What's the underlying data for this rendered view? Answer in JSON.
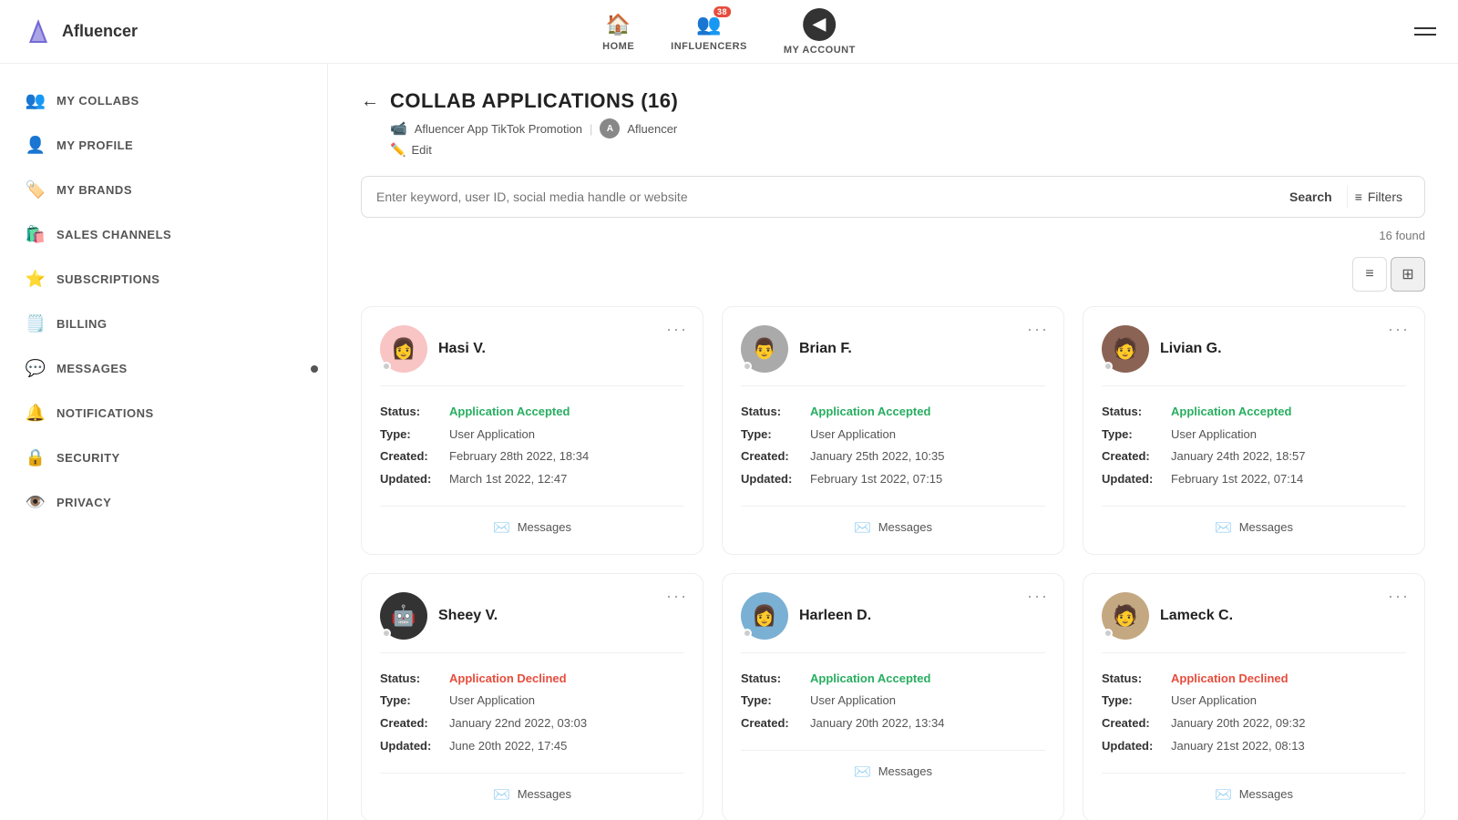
{
  "logo": {
    "text": "Afluencer"
  },
  "topnav": {
    "home_label": "HOME",
    "influencers_label": "INFLUENCERS",
    "my_account_label": "MY ACCOUNT",
    "badge_count": "38"
  },
  "sidebar": {
    "items": [
      {
        "id": "my-collabs",
        "label": "MY COLLABS",
        "icon": "👥"
      },
      {
        "id": "my-profile",
        "label": "MY PROFILE",
        "icon": "👤"
      },
      {
        "id": "my-brands",
        "label": "MY BRANDS",
        "icon": "🏷️"
      },
      {
        "id": "sales-channels",
        "label": "SALES CHANNELS",
        "icon": "🛍️"
      },
      {
        "id": "subscriptions",
        "label": "SUBSCRIPTIONS",
        "icon": "⭐"
      },
      {
        "id": "billing",
        "label": "BILLING",
        "icon": "🗒️"
      },
      {
        "id": "messages",
        "label": "MESSAGES",
        "icon": "💬"
      },
      {
        "id": "notifications",
        "label": "NOTIFICATIONS",
        "icon": "🔔"
      },
      {
        "id": "security",
        "label": "SECURITY",
        "icon": "🔒"
      },
      {
        "id": "privacy",
        "label": "PRIVACY",
        "icon": "👁️"
      }
    ]
  },
  "page": {
    "title": "COLLAB APPLICATIONS (16)",
    "collab_name": "Afluencer App TikTok Promotion",
    "brand_name": "Afluencer",
    "edit_label": "Edit",
    "back_label": "←"
  },
  "search": {
    "placeholder": "Enter keyword, user ID, social media handle or website",
    "button_label": "Search",
    "filter_label": "Filters",
    "results": "16 found"
  },
  "view_toggle": {
    "list_icon": "≡",
    "grid_icon": "⊞"
  },
  "cards": [
    {
      "name": "Hasi V.",
      "avatar_color": "av-pink",
      "avatar_emoji": "👩",
      "status": "Application Accepted",
      "status_type": "accepted",
      "type": "User Application",
      "created": "February 28th 2022, 18:34",
      "updated": "March 1st 2022, 12:47",
      "messages_label": "Messages"
    },
    {
      "name": "Brian F.",
      "avatar_color": "av-gray",
      "avatar_emoji": "👨",
      "status": "Application Accepted",
      "status_type": "accepted",
      "type": "User Application",
      "created": "January 25th 2022, 10:35",
      "updated": "February 1st 2022, 07:15",
      "messages_label": "Messages"
    },
    {
      "name": "Livian G.",
      "avatar_color": "av-brown",
      "avatar_emoji": "🧑",
      "status": "Application Accepted",
      "status_type": "accepted",
      "type": "User Application",
      "created": "January 24th 2022, 18:57",
      "updated": "February 1st 2022, 07:14",
      "messages_label": "Messages"
    },
    {
      "name": "Sheey V.",
      "avatar_color": "av-dark",
      "avatar_emoji": "🤖",
      "status": "Application Declined",
      "status_type": "declined",
      "type": "User Application",
      "created": "January 22nd 2022, 03:03",
      "updated": "June 20th 2022, 17:45",
      "messages_label": "Messages"
    },
    {
      "name": "Harleen D.",
      "avatar_color": "av-blue",
      "avatar_emoji": "👩",
      "status": "Application Accepted",
      "status_type": "accepted",
      "type": "User Application",
      "created": "January 20th 2022, 13:34",
      "updated": "",
      "messages_label": "Messages"
    },
    {
      "name": "Lameck C.",
      "avatar_color": "av-tan",
      "avatar_emoji": "🧑",
      "status": "Application Declined",
      "status_type": "declined",
      "type": "User Application",
      "created": "January 20th 2022, 09:32",
      "updated": "January 21st 2022, 08:13",
      "messages_label": "Messages"
    }
  ],
  "labels": {
    "status": "Status:",
    "type": "Type:",
    "created": "Created:",
    "updated": "Updated:"
  }
}
